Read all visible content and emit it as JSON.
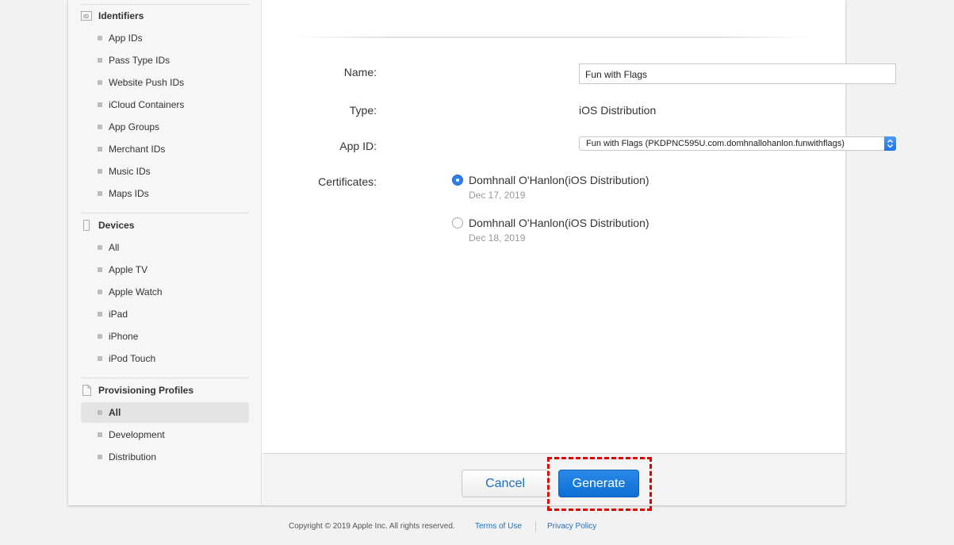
{
  "sidebar": {
    "identifiers": {
      "title": "Identifiers",
      "icon": "id-badge-icon",
      "items": [
        "App IDs",
        "Pass Type IDs",
        "Website Push IDs",
        "iCloud Containers",
        "App Groups",
        "Merchant IDs",
        "Music IDs",
        "Maps IDs"
      ]
    },
    "devices": {
      "title": "Devices",
      "icon": "device-icon",
      "items": [
        "All",
        "Apple TV",
        "Apple Watch",
        "iPad",
        "iPhone",
        "iPod Touch"
      ]
    },
    "profiles": {
      "title": "Provisioning Profiles",
      "icon": "document-icon",
      "items": [
        "All",
        "Development",
        "Distribution"
      ],
      "selected": "All"
    }
  },
  "form": {
    "name_label": "Name:",
    "name_value": "Fun with Flags",
    "type_label": "Type:",
    "type_value": "iOS Distribution",
    "appid_label": "App ID:",
    "appid_value": "Fun with Flags (PKDPNC595U.com.domhnallohanlon.funwithflags)",
    "certs_label": "Certificates:",
    "certificates": [
      {
        "name": "Domhnall O'Hanlon(iOS Distribution)",
        "date": "Dec 17, 2019",
        "selected": true
      },
      {
        "name": "Domhnall O'Hanlon(iOS Distribution)",
        "date": "Dec 18, 2019",
        "selected": false
      }
    ]
  },
  "actions": {
    "cancel": "Cancel",
    "generate": "Generate"
  },
  "footer": {
    "copyright": "Copyright © 2019 Apple Inc. All rights reserved.",
    "terms": "Terms of Use",
    "privacy": "Privacy Policy"
  },
  "colors": {
    "accent": "#1a73e8",
    "highlight": "#e00000",
    "link": "#1a6fc4"
  }
}
